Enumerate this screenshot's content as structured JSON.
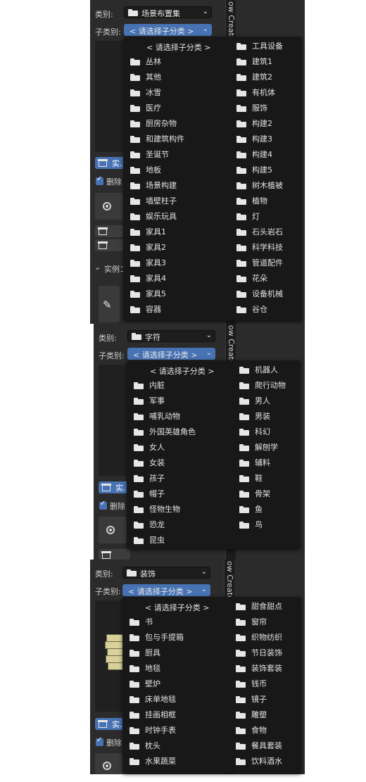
{
  "panels": [
    {
      "side_tab": "ow Creato",
      "category_label": "类别:",
      "category_value": "场景布置集",
      "subcategory_label": "子类别:",
      "subcategory_value": "< 请选择子分类 >",
      "dropdown": {
        "header": "< 请选择子分类 >",
        "left": [
          "丛林",
          "其他",
          "冰雪",
          "医疗",
          "厨房杂物",
          "和建筑构件",
          "圣诞节",
          "地板",
          "场景构建",
          "墙壁柱子",
          "娱乐玩具",
          "家具1",
          "家具2",
          "家具3",
          "家具4",
          "家具5",
          "容器"
        ],
        "right": [
          "工具设备",
          "建筑1",
          "建筑2",
          "有机体",
          "服饰",
          "构建2",
          "构建3",
          "构建4",
          "构建5",
          "树木植被",
          "植物",
          "灯",
          "石头岩石",
          "科学科技",
          "管道配件",
          "花朵",
          "设备机械",
          "谷仓"
        ]
      },
      "fragments": {
        "instance_btn": "实.",
        "delete_label": "删除",
        "instance_section": "实例コ"
      }
    },
    {
      "side_tab": "ow Creato",
      "category_label": "类别:",
      "category_value": "字符",
      "subcategory_label": "子类别:",
      "subcategory_value": "< 请选择子分类 >",
      "dropdown": {
        "header": "< 请选择子分类 >",
        "left": [
          "内脏",
          "军事",
          "哺乳动物",
          "外国英雄角色",
          "女人",
          "女装",
          "孩子",
          "帽子",
          "怪物生物",
          "恐龙",
          "昆虫"
        ],
        "right": [
          "机器人",
          "爬行动物",
          "男人",
          "男装",
          "科幻",
          "解刨学",
          "辅料",
          "鞋",
          "骨架",
          "鱼",
          "鸟"
        ]
      },
      "fragments": {
        "instance_btn": "实.",
        "delete_label": "删除"
      }
    },
    {
      "side_tab": "ow Creato",
      "category_label": "类别:",
      "category_value": "装饰",
      "subcategory_label": "子类别:",
      "subcategory_value": "< 请选择子分类 >",
      "dropdown": {
        "header": "< 请选择子分类 >",
        "left": [
          "书",
          "包与手提箱",
          "厨具",
          "地毯",
          "壁炉",
          "床单地毯",
          "挂画相框",
          "时钟手表",
          "枕头",
          "水果蔬菜"
        ],
        "right": [
          "甜食甜点",
          "窗帘",
          "织物纺织",
          "节日装饰",
          "装饰套装",
          "钱币",
          "镜子",
          "雕塑",
          "食物",
          "餐具套装",
          "饮料酒水"
        ]
      },
      "fragments": {
        "instance_btn": "实.",
        "delete_label": "删除"
      }
    }
  ],
  "colors": {
    "panel_bg": "#2b2b2b",
    "dropdown_bg": "#181818",
    "accent": "#4772b3"
  },
  "icons": {
    "folder": "folder-icon",
    "archive": "archive-icon",
    "target": "target-icon",
    "pencil": "pencil-icon",
    "chevron": "chevron-down-icon"
  }
}
